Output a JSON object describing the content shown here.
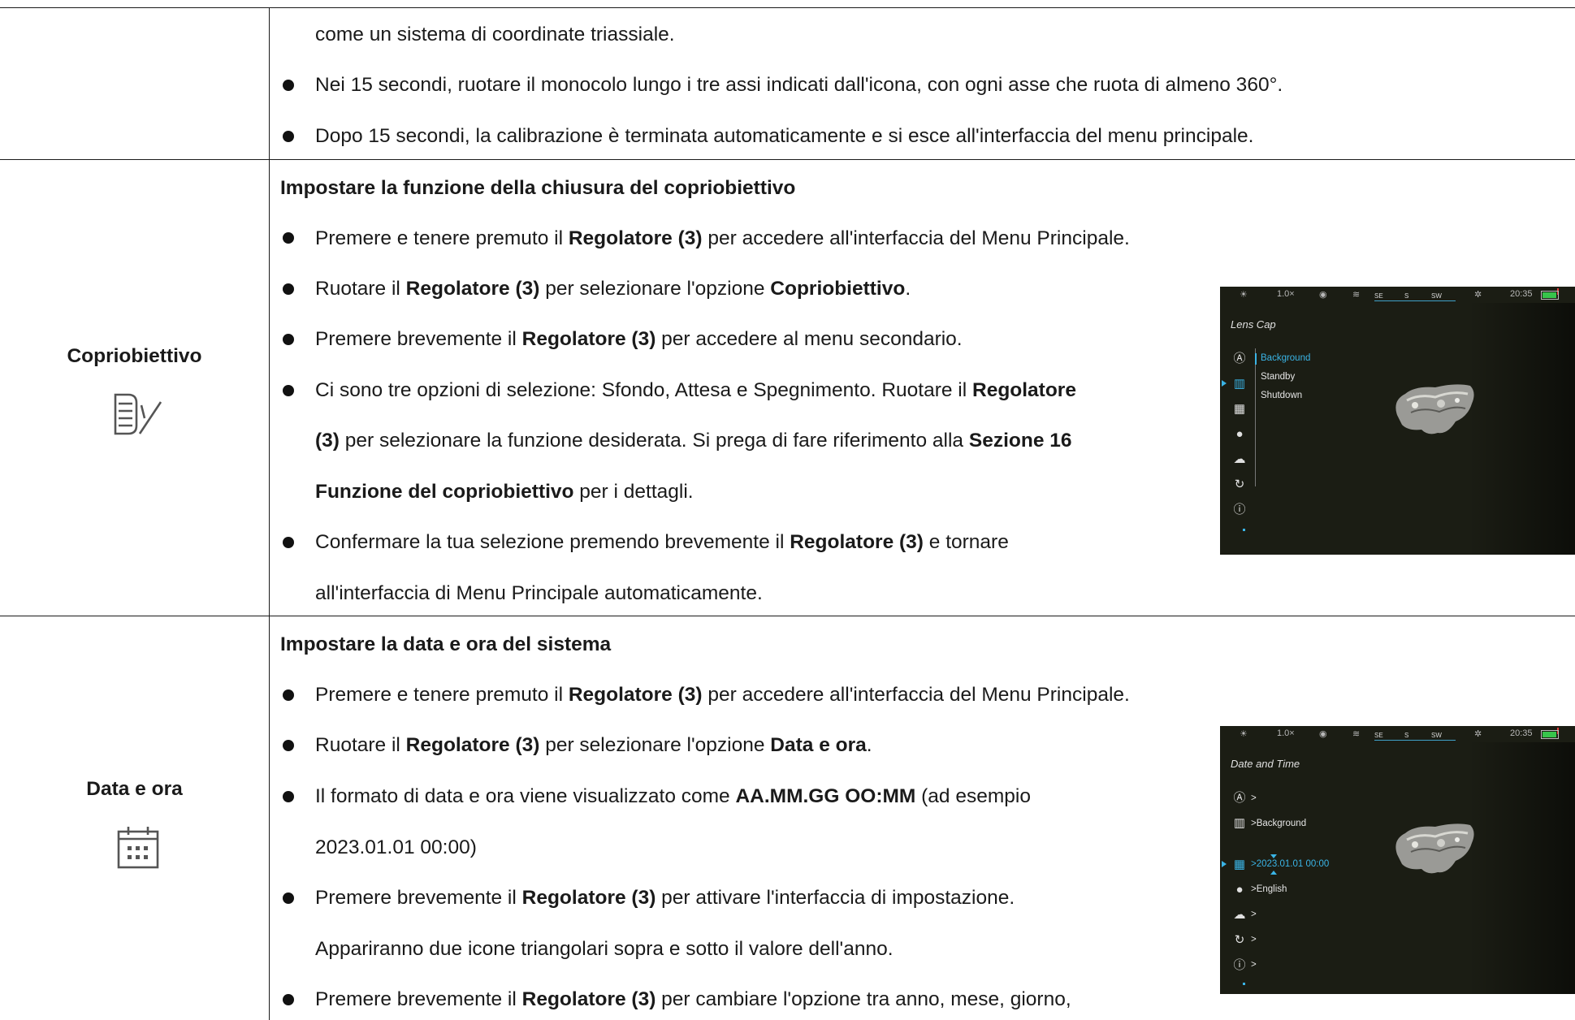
{
  "rows": {
    "continuation": {
      "lines": [
        "come un sistema di coordinate triassiale.",
        "Nei 15 secondi, ruotare il monocolo lungo i tre assi indicati dall'icona, con ogni asse che ruota di almeno 360°.",
        "Dopo 15 secondi, la calibrazione è terminata automaticamente e si esce all'interfaccia del menu principale."
      ]
    },
    "lens_cap": {
      "label": "Copriobiettivo",
      "icon": "lens-cap-icon",
      "heading": "Impostare la funzione della chiusura del copriobiettivo",
      "b1": {
        "t1": "Premere e tenere premuto il ",
        "b1": "Regolatore (3)",
        "t2": " per accedere all'interfaccia del Menu Principale."
      },
      "b2": {
        "t1": "Ruotare il ",
        "b1": "Regolatore (3)",
        "t2": " per selezionare l'opzione ",
        "b2": "Copriobiettivo",
        "t3": "."
      },
      "b3": {
        "t1": "Premere brevemente il ",
        "b1": "Regolatore (3)",
        "t2": " per accedere al menu secondario."
      },
      "b4": {
        "l1_t1": "Ci sono tre opzioni di selezione: Sfondo, Attesa e Spegnimento. Ruotare il ",
        "l1_b1": "Regolatore",
        "l2_b1": "(3)",
        "l2_t1": " per selezionare la funzione desiderata. Si prega di fare riferimento alla ",
        "l2_b2": "Sezione 16",
        "l3_b1": "Funzione del copriobiettivo",
        "l3_t1": " per i dettagli."
      },
      "b5": {
        "l1_t1": "Confermare la tua selezione premendo brevemente il ",
        "l1_b1": "Regolatore (3)",
        "l1_t2": " e tornare",
        "l2_t1": "all'interfaccia di Menu Principale automaticamente."
      },
      "screen": {
        "zoom": "1.0×",
        "time": "20:35",
        "compass": [
          "SE",
          "S",
          "SW"
        ],
        "title": "Lens Cap",
        "options": [
          "Background",
          "Standby",
          "Shutdown"
        ],
        "selected_option": "Background"
      }
    },
    "date_time": {
      "label": "Data e ora",
      "icon": "calendar-icon",
      "heading": "Impostare la data e ora del sistema",
      "b1": {
        "t1": "Premere e tenere premuto il ",
        "b1": "Regolatore (3)",
        "t2": " per accedere all'interfaccia del Menu Principale."
      },
      "b2": {
        "t1": "Ruotare il ",
        "b1": "Regolatore (3)",
        "t2": " per selezionare l'opzione ",
        "b2": "Data e ora",
        "t3": "."
      },
      "b3": {
        "l1_t1": "Il formato di data e ora viene visualizzato come ",
        "l1_b1": "AA.MM.GG OO:MM",
        "l1_t2": " (ad esempio",
        "l2_t1": "2023.01.01 00:00)"
      },
      "b4": {
        "l1_t1": "Premere brevemente il ",
        "l1_b1": "Regolatore (3)",
        "l1_t2": " per attivare l'interfaccia di impostazione.",
        "l2_t1": "Appariranno due icone triangolari sopra e sotto il valore dell'anno."
      },
      "b5": {
        "t1": "Premere brevemente il ",
        "b1": "Regolatore (3)",
        "t2": " per cambiare l'opzione tra anno, mese, giorno,"
      },
      "screen": {
        "zoom": "1.0×",
        "time": "20:35",
        "compass": [
          "SE",
          "S",
          "SW"
        ],
        "title": "Date and Time",
        "menu": [
          ">",
          ">Background",
          ">2023.01.01  00:00",
          ">English",
          ">",
          ">",
          ">"
        ],
        "selected_value": ">2023.01.01  00:00"
      }
    }
  },
  "colors": {
    "accent": "#3ab4e6",
    "text": "#1a1a1a",
    "screen_bg": "#1b1d14"
  }
}
